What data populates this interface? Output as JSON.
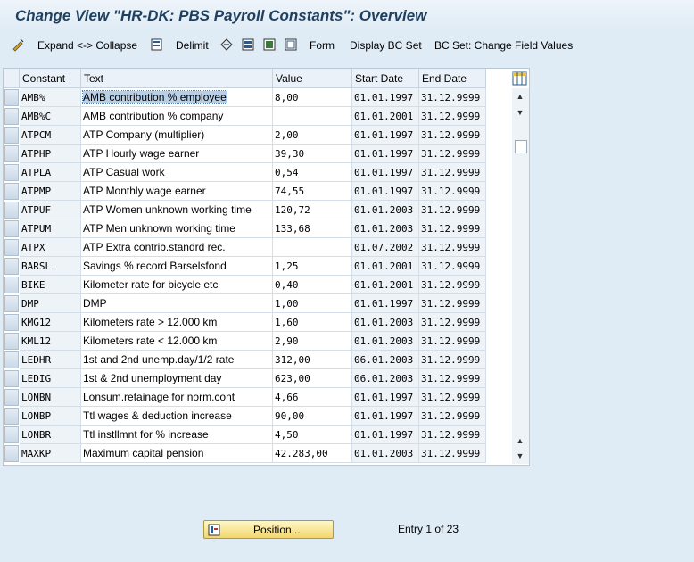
{
  "window": {
    "title": "Change View \"HR-DK: PBS Payroll Constants\": Overview"
  },
  "toolbar": {
    "expand_collapse": "Expand <-> Collapse",
    "delimit": "Delimit",
    "form": "Form",
    "display_bc_set": "Display BC Set",
    "bc_set_change": "BC Set: Change Field Values"
  },
  "table": {
    "headers": [
      "Constant",
      "Text",
      "Value",
      "Start Date",
      "End Date"
    ],
    "rows": [
      {
        "constant": "AMB%",
        "text": "AMB contribution % employee",
        "value": "8,00",
        "start": "01.01.1997",
        "end": "31.12.9999"
      },
      {
        "constant": "AMB%C",
        "text": "AMB contribution % company",
        "value": "",
        "start": "01.01.2001",
        "end": "31.12.9999"
      },
      {
        "constant": "ATPCM",
        "text": "ATP Company (multiplier)",
        "value": "2,00",
        "start": "01.01.1997",
        "end": "31.12.9999"
      },
      {
        "constant": "ATPHP",
        "text": "ATP Hourly wage earner",
        "value": "39,30",
        "start": "01.01.1997",
        "end": "31.12.9999"
      },
      {
        "constant": "ATPLA",
        "text": "ATP Casual work",
        "value": "0,54",
        "start": "01.01.1997",
        "end": "31.12.9999"
      },
      {
        "constant": "ATPMP",
        "text": "ATP Monthly wage earner",
        "value": "74,55",
        "start": "01.01.1997",
        "end": "31.12.9999"
      },
      {
        "constant": "ATPUF",
        "text": "ATP Women unknown working time",
        "value": "120,72",
        "start": "01.01.2003",
        "end": "31.12.9999"
      },
      {
        "constant": "ATPUM",
        "text": "ATP Men unknown working time",
        "value": "133,68",
        "start": "01.01.2003",
        "end": "31.12.9999"
      },
      {
        "constant": "ATPX",
        "text": "ATP Extra contrib.standrd rec.",
        "value": "",
        "start": "01.07.2002",
        "end": "31.12.9999"
      },
      {
        "constant": "BARSL",
        "text": "Savings % record Barselsfond",
        "value": "1,25",
        "start": "01.01.2001",
        "end": "31.12.9999"
      },
      {
        "constant": "BIKE",
        "text": "Kilometer rate for bicycle etc",
        "value": "0,40",
        "start": "01.01.2001",
        "end": "31.12.9999"
      },
      {
        "constant": "DMP",
        "text": "DMP",
        "value": "1,00",
        "start": "01.01.1997",
        "end": "31.12.9999"
      },
      {
        "constant": "KMG12",
        "text": "Kilometers rate > 12.000 km",
        "value": "1,60",
        "start": "01.01.2003",
        "end": "31.12.9999"
      },
      {
        "constant": "KML12",
        "text": "Kilometers rate < 12.000 km",
        "value": "2,90",
        "start": "01.01.2003",
        "end": "31.12.9999"
      },
      {
        "constant": "LEDHR",
        "text": "1st and 2nd unemp.day/1/2 rate",
        "value": "312,00",
        "start": "06.01.2003",
        "end": "31.12.9999"
      },
      {
        "constant": "LEDIG",
        "text": "1st & 2nd unemployment day",
        "value": "623,00",
        "start": "06.01.2003",
        "end": "31.12.9999"
      },
      {
        "constant": "LONBN",
        "text": "Lonsum.retainage for norm.cont",
        "value": "4,66",
        "start": "01.01.1997",
        "end": "31.12.9999"
      },
      {
        "constant": "LONBP",
        "text": "Ttl wages & deduction increase",
        "value": "90,00",
        "start": "01.01.1997",
        "end": "31.12.9999"
      },
      {
        "constant": "LONBR",
        "text": "Ttl instllmnt for % increase",
        "value": "4,50",
        "start": "01.01.1997",
        "end": "31.12.9999"
      },
      {
        "constant": "MAXKP",
        "text": "Maximum capital pension",
        "value": "42.283,00",
        "start": "01.01.2003",
        "end": "31.12.9999"
      }
    ]
  },
  "footer": {
    "position_button": "Position...",
    "entry_info": "Entry 1 of 23"
  },
  "colors": {
    "background": "#dfebf5",
    "title": "#1f3f5f",
    "button": "#f3d66e"
  }
}
